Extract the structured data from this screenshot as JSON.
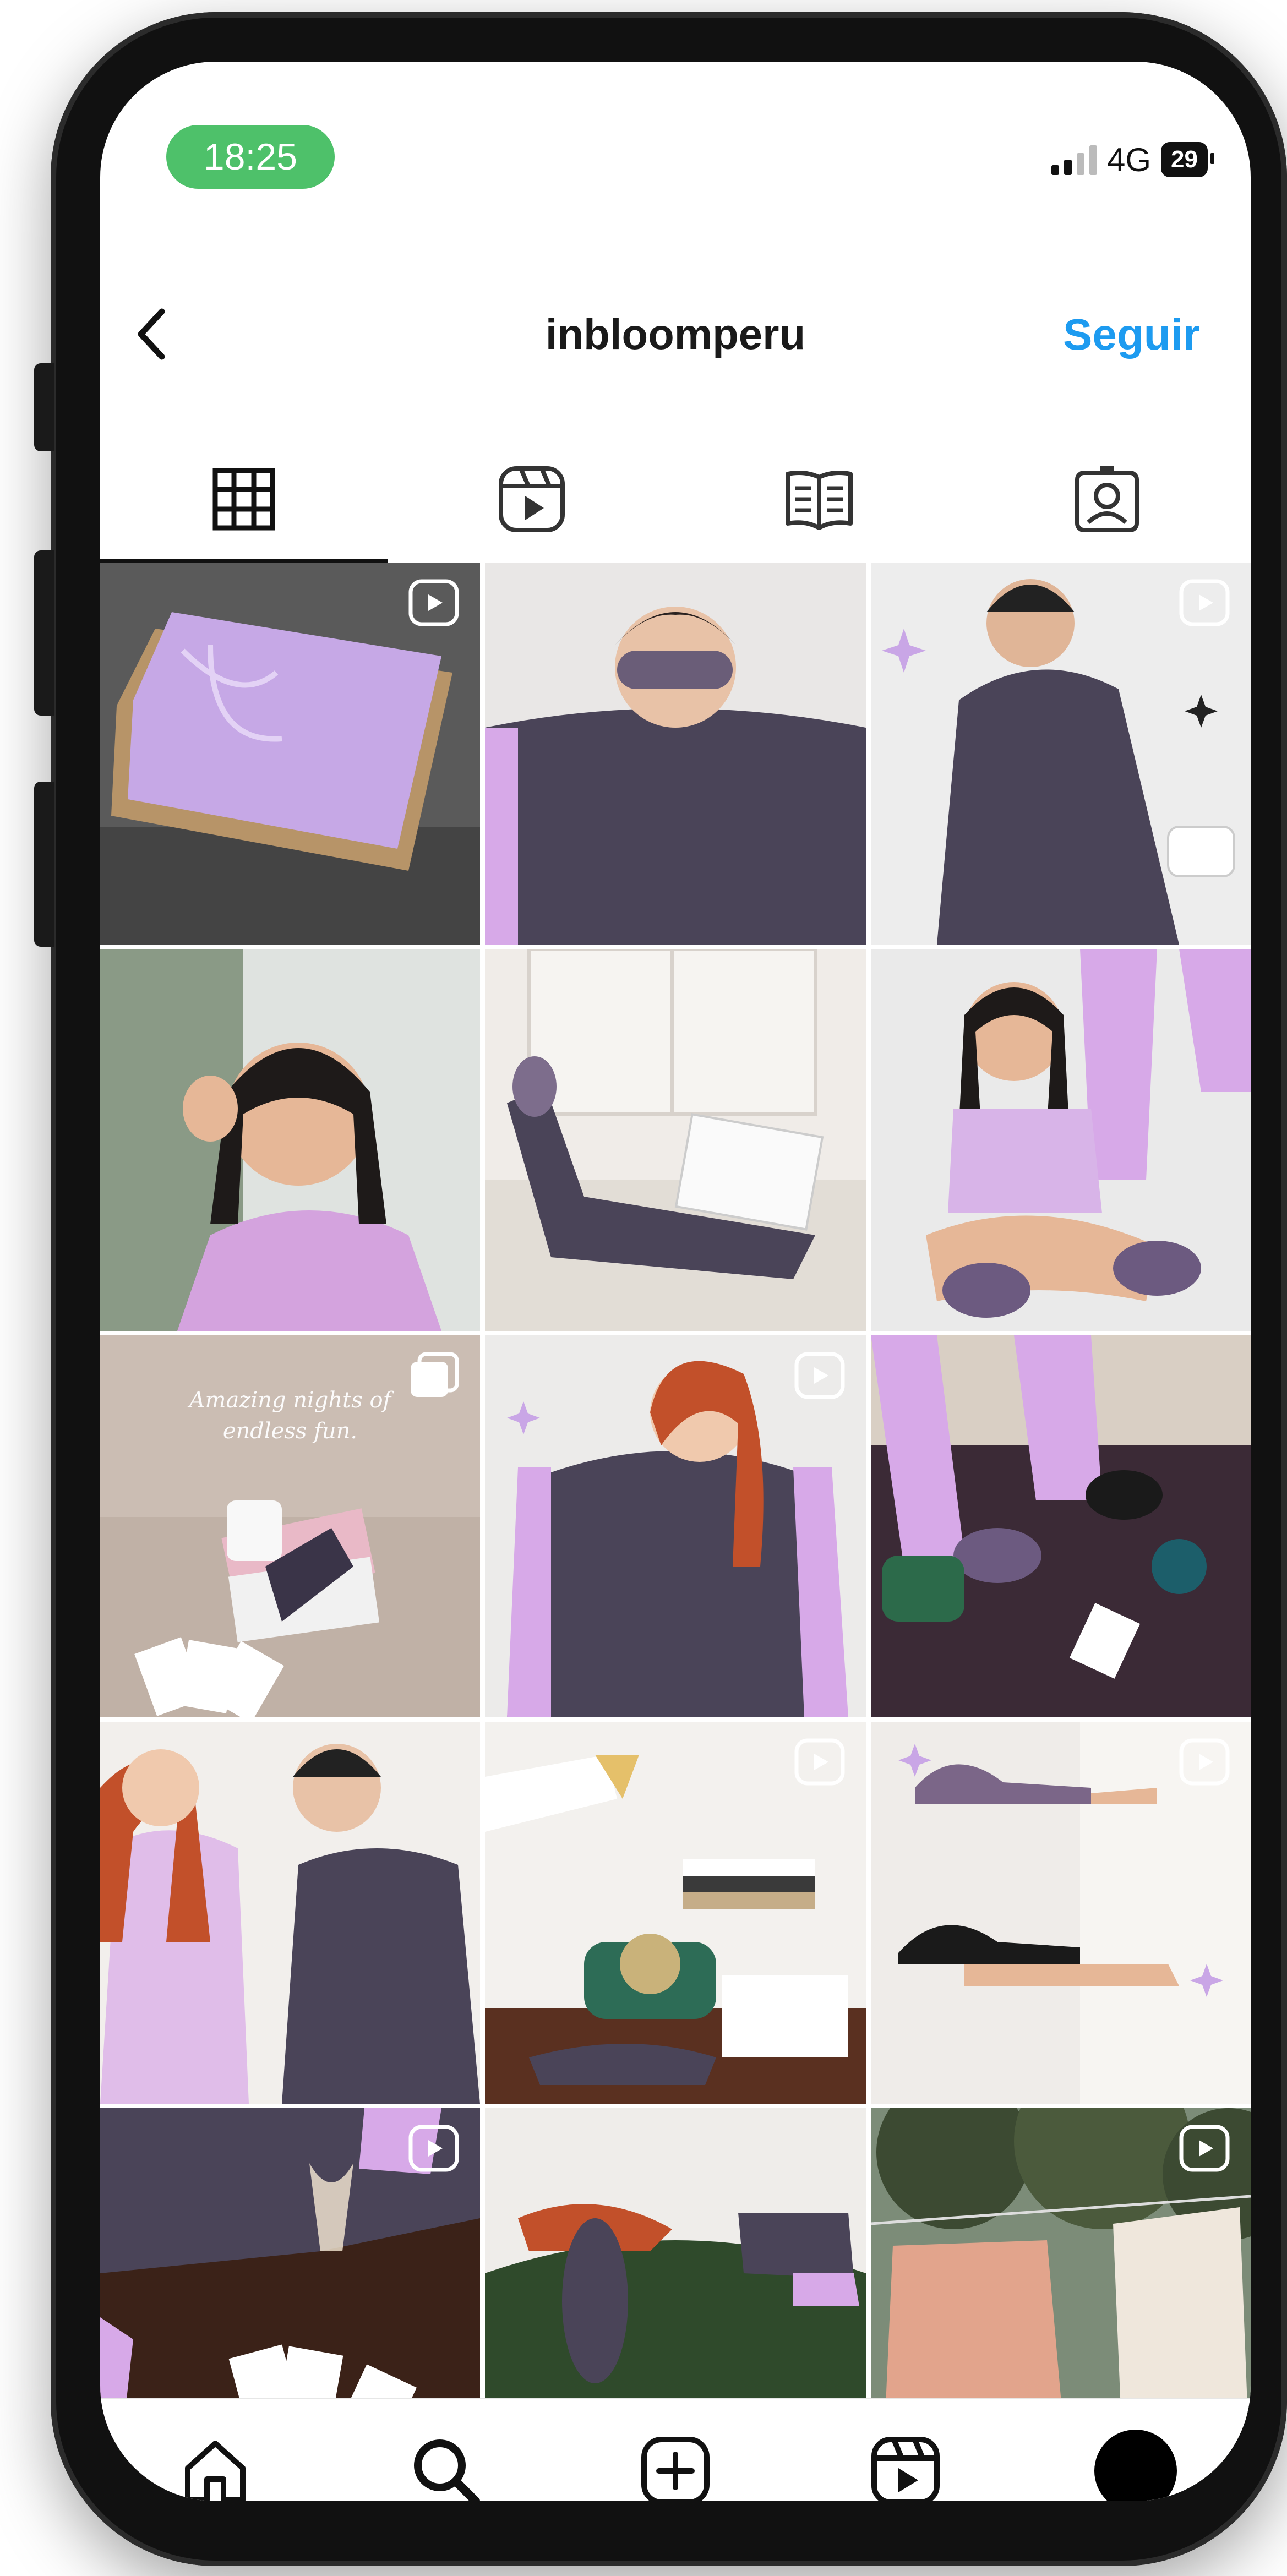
{
  "status_bar": {
    "time": "18:25",
    "network": "4G",
    "battery": "29"
  },
  "header": {
    "username": "inbloomperu",
    "follow_label": "Seguir"
  },
  "tabs": [
    {
      "name": "grid",
      "icon": "grid-icon",
      "active": true
    },
    {
      "name": "reels",
      "icon": "reels-icon",
      "active": false
    },
    {
      "name": "guides",
      "icon": "guides-icon",
      "active": false
    },
    {
      "name": "tagged",
      "icon": "tagged-icon",
      "active": false
    }
  ],
  "posts": [
    {
      "id": 1,
      "badge": "reel-icon",
      "overlay_text": ""
    },
    {
      "id": 2,
      "badge": "",
      "overlay_text": ""
    },
    {
      "id": 3,
      "badge": "reel-icon",
      "overlay_text": ""
    },
    {
      "id": 4,
      "badge": "",
      "overlay_text": ""
    },
    {
      "id": 5,
      "badge": "",
      "overlay_text": ""
    },
    {
      "id": 6,
      "badge": "",
      "overlay_text": ""
    },
    {
      "id": 7,
      "badge": "carousel-icon",
      "overlay_text": "Amazing nights of endless fun."
    },
    {
      "id": 8,
      "badge": "reel-icon",
      "overlay_text": ""
    },
    {
      "id": 9,
      "badge": "",
      "overlay_text": ""
    },
    {
      "id": 10,
      "badge": "",
      "overlay_text": ""
    },
    {
      "id": 11,
      "badge": "reel-icon",
      "overlay_text": ""
    },
    {
      "id": 12,
      "badge": "reel-icon",
      "overlay_text": ""
    },
    {
      "id": 13,
      "badge": "reel-icon",
      "overlay_text": ""
    },
    {
      "id": 14,
      "badge": "",
      "overlay_text": ""
    },
    {
      "id": 15,
      "badge": "reel-icon",
      "overlay_text": ""
    }
  ],
  "bottom_nav": [
    {
      "name": "home",
      "icon": "home-icon",
      "notification_dot": true
    },
    {
      "name": "search",
      "icon": "search-icon",
      "notification_dot": false
    },
    {
      "name": "create",
      "icon": "plus-square-icon",
      "notification_dot": false
    },
    {
      "name": "reels",
      "icon": "reels-icon",
      "notification_dot": false
    },
    {
      "name": "profile",
      "icon": "avatar",
      "notification_dot": true
    }
  ],
  "colors": {
    "accent": "#1d9bf0",
    "status_pill": "#4ec16a",
    "notification_dot": "#e5304a",
    "brand_lilac": "#c9a6e6"
  }
}
